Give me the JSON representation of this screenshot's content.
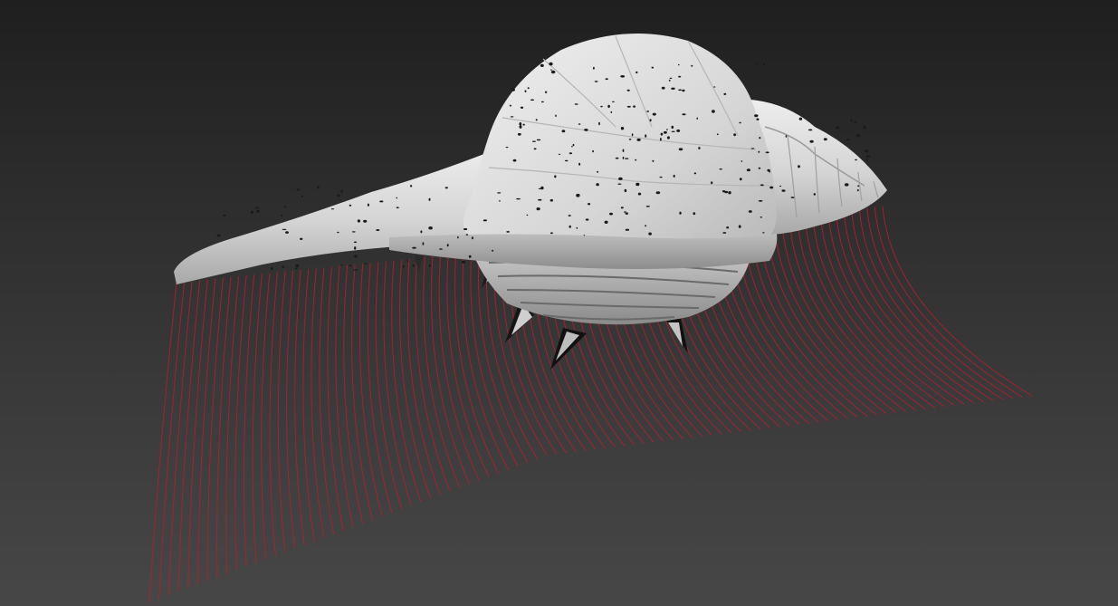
{
  "viewport": {
    "background_top": "#1f1f1f",
    "background_bottom": "#474747"
  },
  "model": {
    "shell_color": "#d9d9d9",
    "shell_shadow": "#9a9a9a",
    "speck_color": "#1a1a1a",
    "spike_color": "#111111",
    "hair_color": "#b0202a"
  }
}
